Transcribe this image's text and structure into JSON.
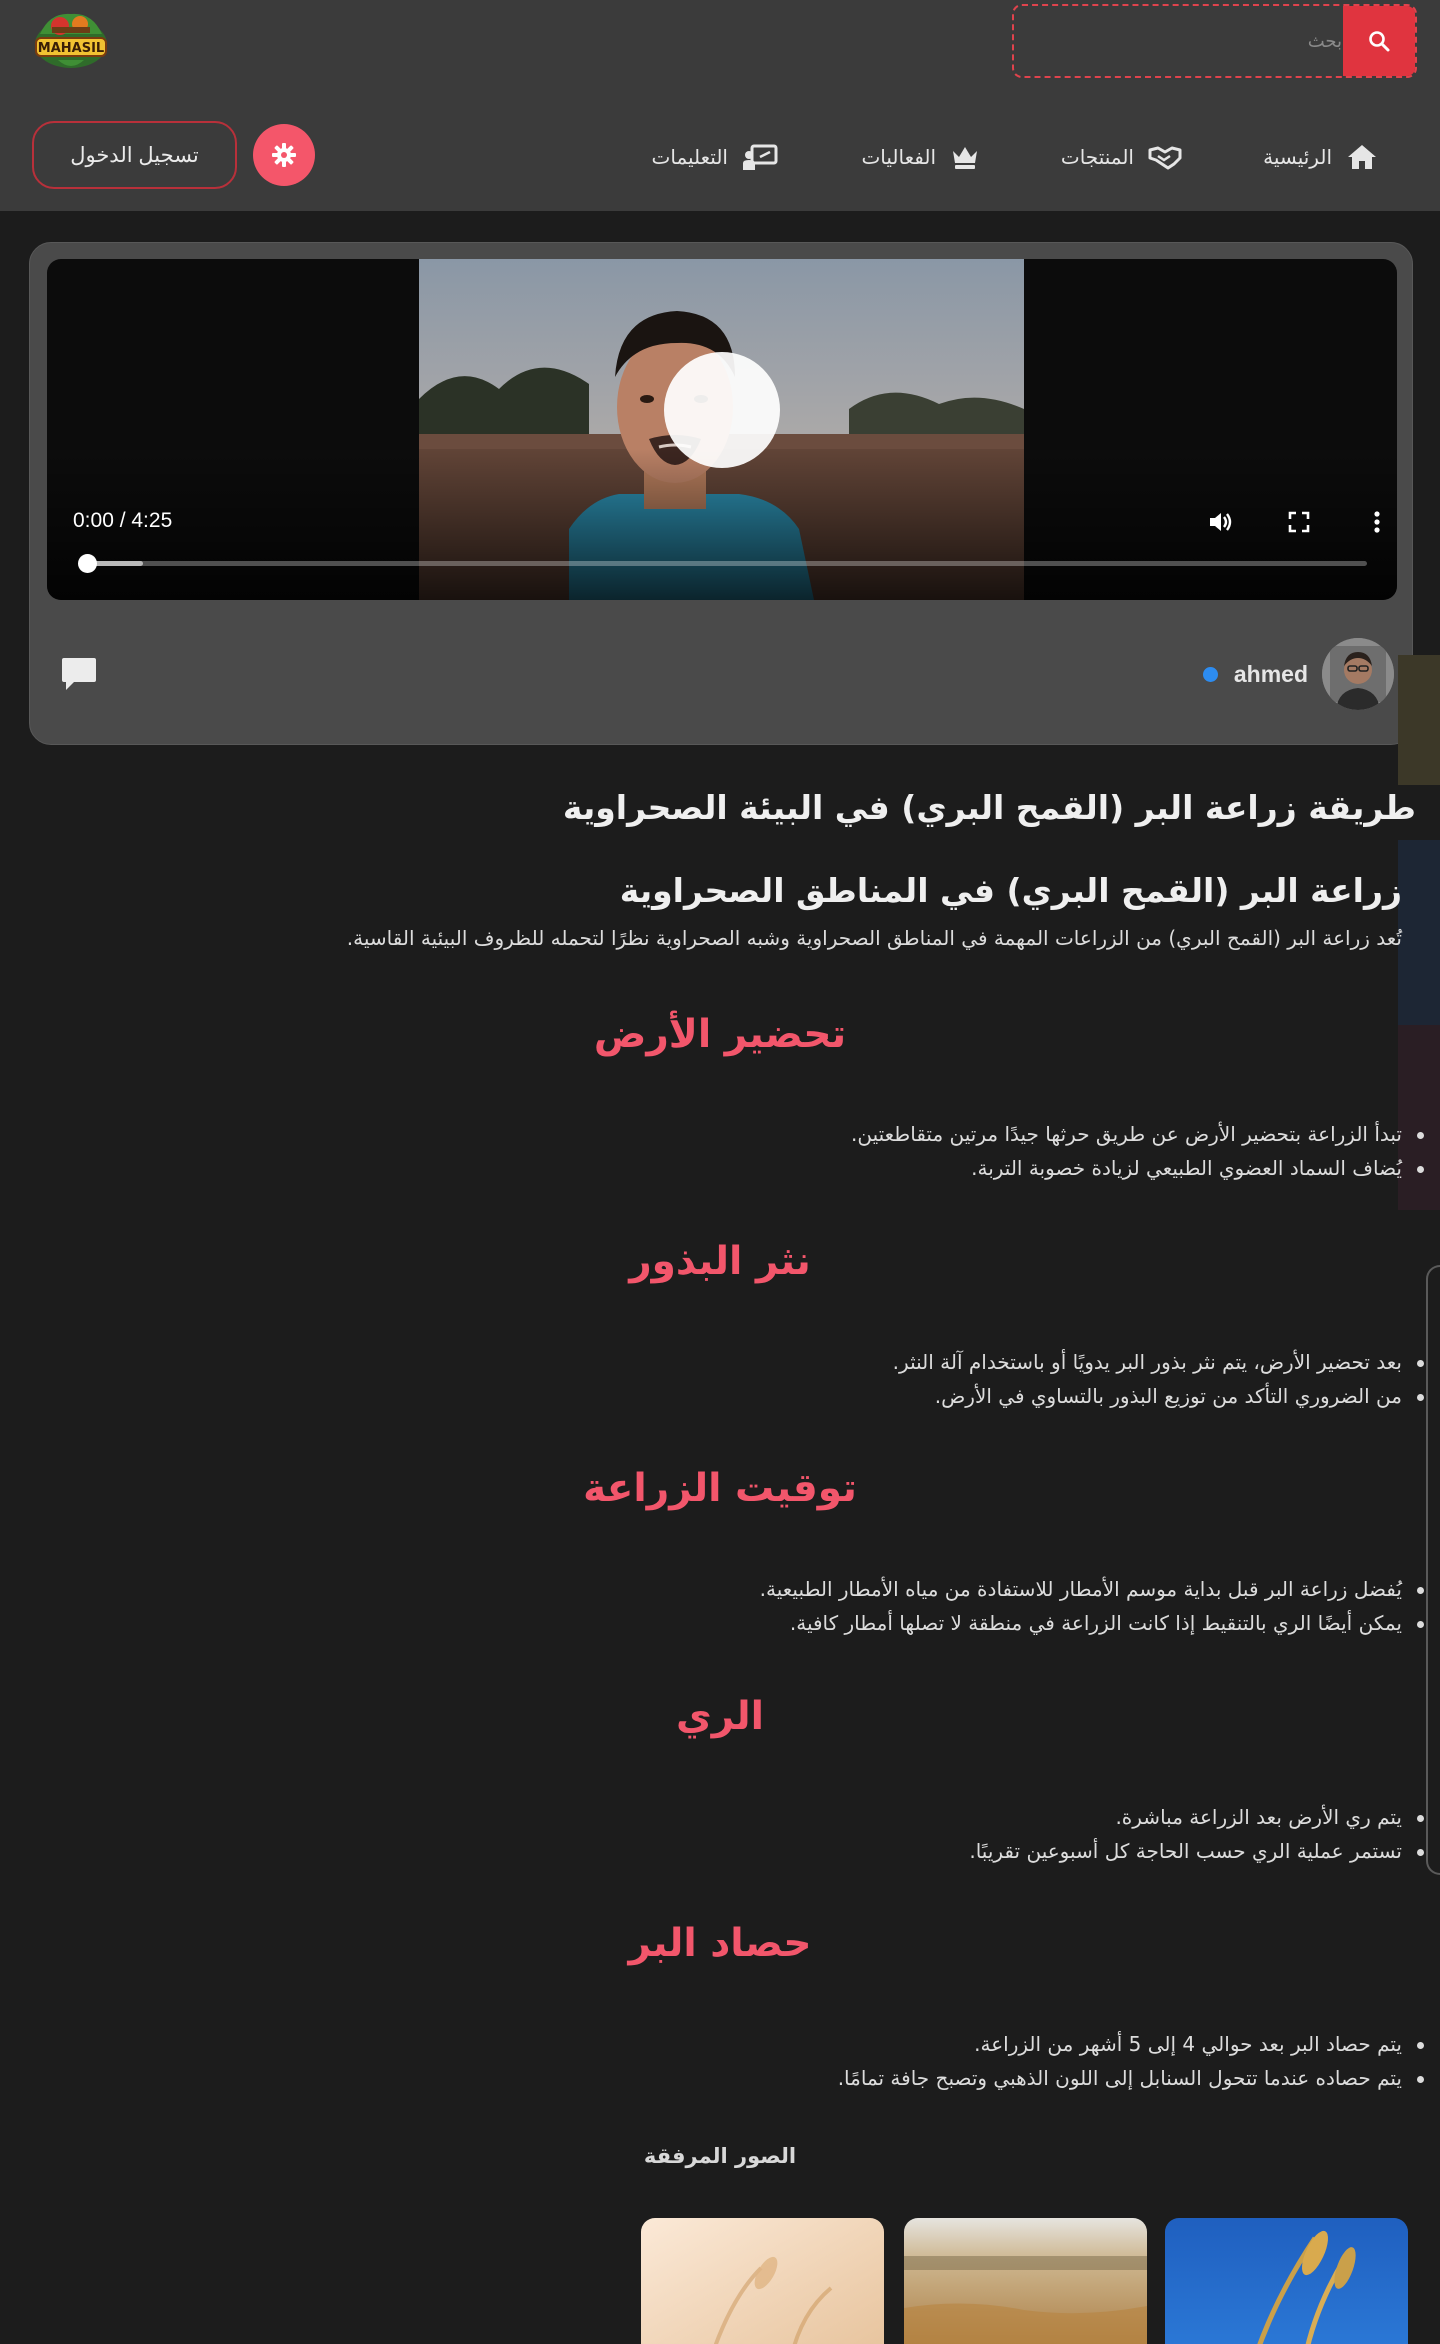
{
  "header": {
    "logo_text": "MAHASIL",
    "search": {
      "placeholder": "بحث"
    },
    "nav": [
      {
        "label": "الرئيسية",
        "icon": "home-icon"
      },
      {
        "label": "المنتجات",
        "icon": "handshake-icon"
      },
      {
        "label": "الفعاليات",
        "icon": "crown-icon"
      },
      {
        "label": "التعليمات",
        "icon": "presentation-icon"
      }
    ],
    "login_label": "تسجيل الدخول"
  },
  "video": {
    "time_display": "0:00 / 4:25",
    "progress": 0,
    "author_name": "ahmed"
  },
  "article": {
    "title": "طريقة زراعة البر (القمح البري) في البيئة الصحراوية",
    "subtitle": "زراعة البر (القمح البري) في المناطق الصحراوية",
    "intro": "تُعد زراعة البر (القمح البري) من الزراعات المهمة في المناطق الصحراوية وشبه الصحراوية نظرًا لتحمله للظروف البيئية القاسية.",
    "sections": [
      {
        "heading": "تحضير الأرض",
        "bullets": [
          "تبدأ الزراعة بتحضير الأرض عن طريق حرثها جيدًا مرتين متقاطعتين.",
          "يُضاف السماد العضوي الطبيعي لزيادة خصوبة التربة."
        ]
      },
      {
        "heading": "نثر البذور",
        "bullets": [
          "بعد تحضير الأرض، يتم نثر بذور البر يدويًا أو باستخدام آلة النثر.",
          "من الضروري التأكد من توزيع البذور بالتساوي في الأرض."
        ]
      },
      {
        "heading": "توقيت الزراعة",
        "bullets": [
          "يُفضل زراعة البر قبل بداية موسم الأمطار للاستفادة من مياه الأمطار الطبيعية.",
          "يمكن أيضًا الري بالتنقيط إذا كانت الزراعة في منطقة لا تصلها أمطار كافية."
        ]
      },
      {
        "heading": "الري",
        "bullets": [
          "يتم ري الأرض بعد الزراعة مباشرة.",
          "تستمر عملية الري حسب الحاجة كل أسبوعين تقريبًا."
        ]
      },
      {
        "heading": "حصاد البر",
        "bullets": [
          "يتم حصاد البر بعد حوالي 4 إلى 5 أشهر من الزراعة.",
          "يتم حصاده عندما تتحول السنابل إلى اللون الذهبي وتصبح جافة تمامًا."
        ]
      }
    ],
    "attached_title": "الصور المرفقة"
  },
  "colors": {
    "accent": "#f2566b",
    "header_bg": "#3b3b3b",
    "page_bg": "#1c1c1c",
    "search_button": "#e0343f"
  }
}
